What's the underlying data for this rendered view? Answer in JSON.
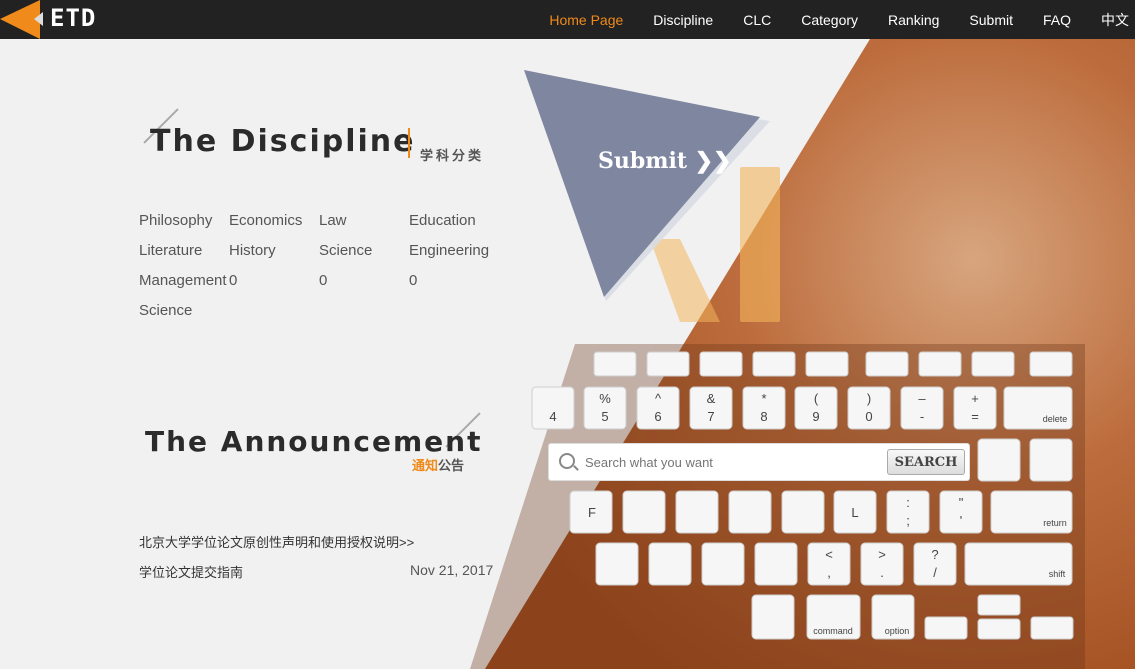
{
  "header": {
    "logo_text": "ETD",
    "nav": [
      {
        "label": "Home Page",
        "active": true
      },
      {
        "label": "Discipline",
        "active": false
      },
      {
        "label": "CLC",
        "active": false
      },
      {
        "label": "Category",
        "active": false
      },
      {
        "label": "Ranking",
        "active": false
      },
      {
        "label": "Submit",
        "active": false
      },
      {
        "label": "FAQ",
        "active": false
      },
      {
        "label": "中文",
        "active": false
      }
    ]
  },
  "discipline": {
    "title": "The Discipline",
    "subtitle": "学科分类",
    "rows": [
      [
        "Philosophy",
        "Economics",
        "Law",
        "Education"
      ],
      [
        "Literature",
        "History",
        "Science",
        "Engineering"
      ],
      [
        "Management",
        "0",
        "0",
        "0"
      ],
      [
        "Science",
        "",
        "",
        ""
      ]
    ]
  },
  "announcement": {
    "title": "The Announcement",
    "subtitle_a": "通知",
    "subtitle_b": "公告",
    "items": [
      {
        "text": "北京大学学位论文原创性声明和使用授权说明>>",
        "date": ""
      },
      {
        "text": "学位论文提交指南",
        "date": "Nov 21, 2017"
      }
    ]
  },
  "hero": {
    "submit_label": "Submit ❯❯",
    "search_placeholder": "Search what you want",
    "search_button": "SEARCH"
  },
  "colors": {
    "accent": "#f08a1b",
    "topbar": "#222222",
    "hero_brown": "#b8643a",
    "triangle": "#7f87a0"
  }
}
